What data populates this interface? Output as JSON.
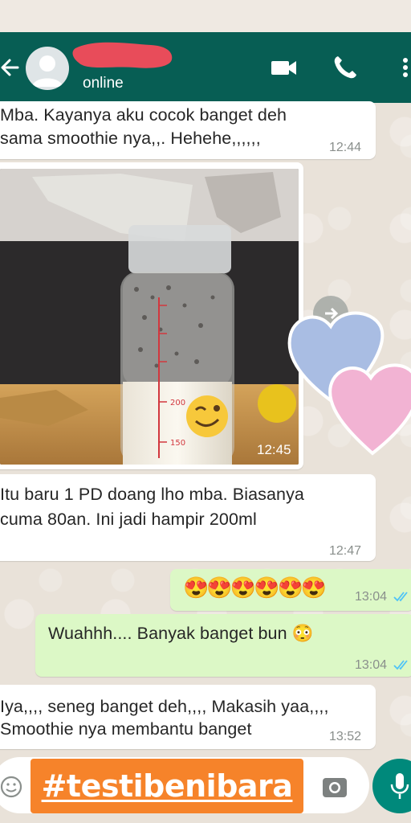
{
  "header": {
    "status": "online",
    "colors": {
      "bar": "#075e54",
      "accent": "#00897b"
    }
  },
  "messages": [
    {
      "direction": "in",
      "lines": [
        "Mba. Kayanya aku cocok banget deh",
        "sama smoothie nya,,. Hehehe,,,,,,"
      ],
      "time": "12:44"
    },
    {
      "direction": "in",
      "type": "image",
      "time": "12:45",
      "bottle_marks": [
        "200",
        "150"
      ]
    },
    {
      "direction": "in",
      "lines": [
        "Itu baru 1 PD doang lho mba. Biasanya",
        "cuma 80an. Ini jadi hampir 200ml"
      ],
      "time": "12:47"
    },
    {
      "direction": "out",
      "emoji": "😍😍😍😍😍😍",
      "time": "13:04",
      "read": true
    },
    {
      "direction": "out",
      "text": "Wuahhh.... Banyak banget bun 😳",
      "time": "13:04",
      "read": true
    },
    {
      "direction": "in",
      "lines": [
        "Iya,,,, seneg banget deh,,,, Makasih yaa,,,,",
        "Smoothie nya membantu banget"
      ],
      "time": "13:52"
    }
  ],
  "composer": {
    "hashtag": "#testibenibara",
    "icons": [
      "emoji-icon",
      "camera-icon",
      "mic-icon"
    ]
  }
}
